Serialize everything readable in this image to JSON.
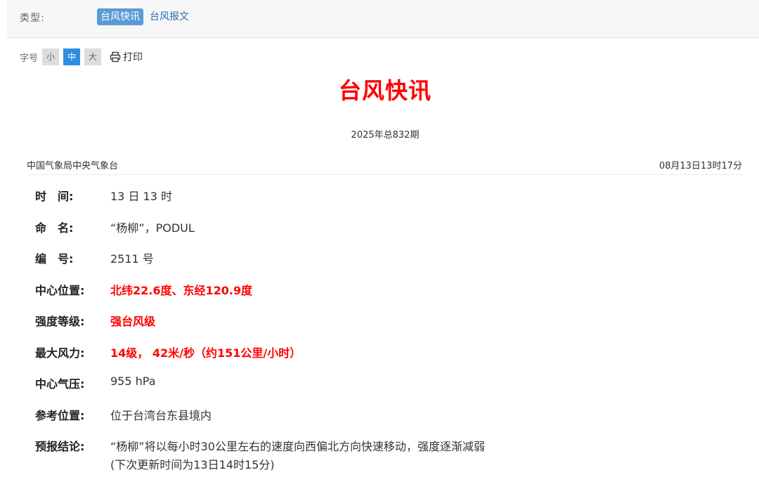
{
  "type_bar": {
    "label": "类型:",
    "tags": [
      {
        "label": "台风快讯",
        "active": true
      },
      {
        "label": "台风报文",
        "active": false
      }
    ]
  },
  "toolbar": {
    "font_label": "字号",
    "sizes": [
      {
        "label": "小",
        "active": false
      },
      {
        "label": "中",
        "active": true
      },
      {
        "label": "大",
        "active": false
      }
    ],
    "print_label": "打印",
    "print_icon": "printer-icon"
  },
  "title": "台风快讯",
  "issue": "2025年总832期",
  "source": {
    "org": "中国气象局中央气象台",
    "time": "08月13日13时17分"
  },
  "info": {
    "time": {
      "key": "时　间:",
      "value": "13 日 13 时"
    },
    "name": {
      "key": "命　名:",
      "value": "“杨柳”，PODUL"
    },
    "number": {
      "key": "编　号:",
      "value": "2511 号"
    },
    "center": {
      "key": "中心位置:",
      "value": "北纬22.6度、东经120.9度"
    },
    "grade": {
      "key": "强度等级:",
      "value": "强台风级"
    },
    "wind": {
      "key": "最大风力:",
      "value": "14级， 42米/秒（约151公里/小时）"
    },
    "pressure": {
      "key": "中心气压:",
      "value": "955 hPa"
    },
    "reference": {
      "key": "参考位置:",
      "value": "位于台湾台东县境内"
    },
    "forecast": {
      "key": "预报结论:",
      "value": "“杨柳”将以每小时30公里左右的速度向西偏北方向快速移动，强度逐渐减弱",
      "next_update": "(下次更新时间为13日14时15分)"
    }
  },
  "colors": {
    "title_red": "#ff0000",
    "active_tag_blue": "#5b9bd5",
    "active_size_blue": "#2e8ee0",
    "link_blue": "#2b6cb0"
  }
}
